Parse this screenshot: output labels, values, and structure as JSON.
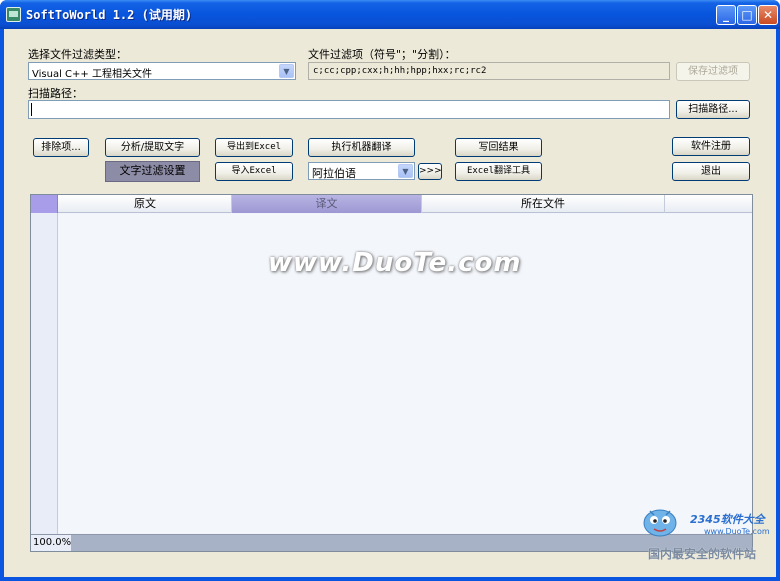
{
  "window": {
    "title": "SoftToWorld 1.2  (试用期)"
  },
  "titlebar": {
    "minimize_glyph": "_",
    "maximize_glyph": "□",
    "close_glyph": "✕"
  },
  "filter_type": {
    "label": "选择文件过滤类型：",
    "selected": "Visual C++ 工程相关文件"
  },
  "filter_items": {
    "label": "文件过滤项（符号\"；\"分割）：",
    "value": "c;cc;cpp;cxx;h;hh;hpp;hxx;rc;rc2",
    "save_label": "保存过滤项"
  },
  "scan_path": {
    "label": "扫描路径：",
    "value": "",
    "button_label": "扫描路径..."
  },
  "toolbar": {
    "exclude_label": "排除项...",
    "analyze_label": "分析/提取文字",
    "text_filter_label": "文字过滤设置",
    "export_excel_label": "导出到Excel",
    "import_excel_label": "导入Excel",
    "machine_translate_label": "执行机器翻译",
    "language_selected": "阿拉伯语",
    "go_label": ">>>",
    "write_back_label": "写回结果",
    "excel_tool_label": "Excel翻译工具",
    "register_label": "软件注册",
    "exit_label": "退出"
  },
  "grid": {
    "columns": [
      "原文",
      "译文",
      "所在文件",
      ""
    ],
    "rows": [],
    "status": "100.0%"
  },
  "watermark": {
    "text": "www.DuoTe.com"
  },
  "logo": {
    "brand": "2345软件大全",
    "url": "www.DuoTe.com",
    "slogan": "国内最安全的软件站"
  },
  "colors": {
    "titlebar": "#0855dd",
    "client_bg": "#ece9d8",
    "selected_column": "#9d98d2",
    "filter_label_bg": "#8d8ca6"
  },
  "icons": {
    "app": "app-icon",
    "dropdown": "chevron-down-icon",
    "mascot": "mascot-icon"
  }
}
